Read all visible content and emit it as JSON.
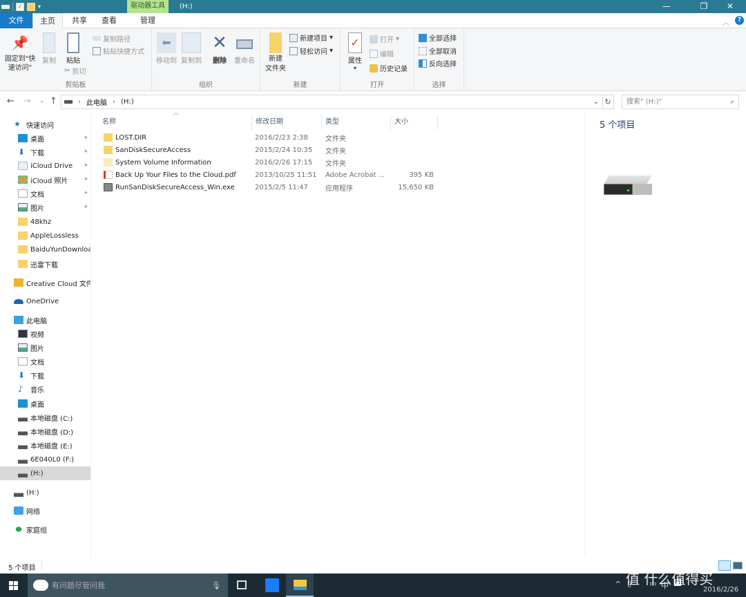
{
  "window": {
    "context_tab_header": "驱动器工具",
    "title": "(H:)",
    "controls": {
      "minimize": "—",
      "maximize": "❐",
      "close": "✕"
    }
  },
  "tabs": [
    {
      "label": "文件"
    },
    {
      "label": "主页"
    },
    {
      "label": "共享"
    },
    {
      "label": "查看"
    },
    {
      "label": "管理"
    }
  ],
  "ribbon": {
    "clipboard": {
      "label": "剪贴板",
      "pin": "固定到\"快速访问\"",
      "copy": "复制",
      "paste": "粘贴",
      "copy_path": "复制路径",
      "paste_shortcut": "粘贴快捷方式",
      "cut": "剪切"
    },
    "organize": {
      "label": "组织",
      "move_to": "移动到",
      "copy_to": "复制到",
      "delete": "删除",
      "rename": "重命名"
    },
    "new": {
      "label": "新建",
      "new_folder": "新建\n文件夹",
      "new_item": "新建项目",
      "easy_access": "轻松访问"
    },
    "open": {
      "label": "打开",
      "properties": "属性",
      "open": "打开",
      "edit": "编辑",
      "history": "历史记录"
    },
    "select": {
      "label": "选择",
      "select_all": "全部选择",
      "select_none": "全部取消",
      "invert": "反向选择"
    }
  },
  "nav": {
    "breadcrumb": [
      "此电脑",
      "(H:)"
    ],
    "search_placeholder": "搜索\" (H:)\""
  },
  "sidebar": {
    "items": [
      {
        "label": "快速访问",
        "icon": "star-icon"
      },
      {
        "label": "桌面",
        "icon": "desktop-icon",
        "pinned": true
      },
      {
        "label": "下载",
        "icon": "download-icon",
        "pinned": true
      },
      {
        "label": "iCloud Drive",
        "icon": "icloud-icon",
        "pinned": true
      },
      {
        "label": "iCloud 照片",
        "icon": "photos-icon",
        "pinned": true
      },
      {
        "label": "文档",
        "icon": "document-icon",
        "pinned": true
      },
      {
        "label": "图片",
        "icon": "picture-icon",
        "pinned": true
      },
      {
        "label": "48khz",
        "icon": "folder-icon"
      },
      {
        "label": "AppleLossless",
        "icon": "folder-icon"
      },
      {
        "label": "BaiduYunDownload",
        "icon": "folder-icon"
      },
      {
        "label": "迅雷下载",
        "icon": "folder-icon"
      },
      {
        "label": "Creative Cloud 文件",
        "icon": "creative-cloud-icon"
      },
      {
        "label": "OneDrive",
        "icon": "onedrive-icon"
      },
      {
        "label": "此电脑",
        "icon": "computer-icon"
      },
      {
        "label": "视频",
        "icon": "video-icon"
      },
      {
        "label": "图片",
        "icon": "picture-icon"
      },
      {
        "label": "文档",
        "icon": "document-icon"
      },
      {
        "label": "下载",
        "icon": "download-icon"
      },
      {
        "label": "音乐",
        "icon": "music-icon"
      },
      {
        "label": "桌面",
        "icon": "desktop-icon"
      },
      {
        "label": "本地磁盘 (C:)",
        "icon": "system-drive-icon"
      },
      {
        "label": "本地磁盘 (D:)",
        "icon": "drive-icon"
      },
      {
        "label": "本地磁盘 (E:)",
        "icon": "drive-icon"
      },
      {
        "label": "6E040L0 (F:)",
        "icon": "drive-icon"
      },
      {
        "label": "(H:)",
        "icon": "drive-icon",
        "selected": true
      },
      {
        "label": "(H:)",
        "icon": "drive-icon"
      },
      {
        "label": "网络",
        "icon": "network-icon"
      },
      {
        "label": "家庭组",
        "icon": "homegroup-icon"
      }
    ]
  },
  "columns": {
    "name": "名称",
    "date": "修改日期",
    "type": "类型",
    "size": "大小"
  },
  "files": [
    {
      "name": "LOST.DIR",
      "date": "2016/2/23 2:38",
      "type": "文件夹",
      "size": "",
      "icon": "folder-icon"
    },
    {
      "name": "SanDiskSecureAccess",
      "date": "2015/2/24 10:35",
      "type": "文件夹",
      "size": "",
      "icon": "folder-icon"
    },
    {
      "name": "System Volume Information",
      "date": "2016/2/26 17:15",
      "type": "文件夹",
      "size": "",
      "icon": "hidden-folder-icon"
    },
    {
      "name": "Back Up Your Files to the Cloud.pdf",
      "date": "2013/10/25 11:51",
      "type": "Adobe Acrobat ...",
      "size": "395 KB",
      "icon": "pdf-icon"
    },
    {
      "name": "RunSanDiskSecureAccess_Win.exe",
      "date": "2015/2/5 11:47",
      "type": "应用程序",
      "size": "15,650 KB",
      "icon": "exe-icon"
    }
  ],
  "preview": {
    "count": "5 个项目"
  },
  "status": {
    "count": "5 个项目"
  },
  "taskbar": {
    "search_placeholder": "有问题尽管问我",
    "clock_date": "2016/2/26",
    "ime": "中",
    "watermark": "值 什么值得买"
  }
}
